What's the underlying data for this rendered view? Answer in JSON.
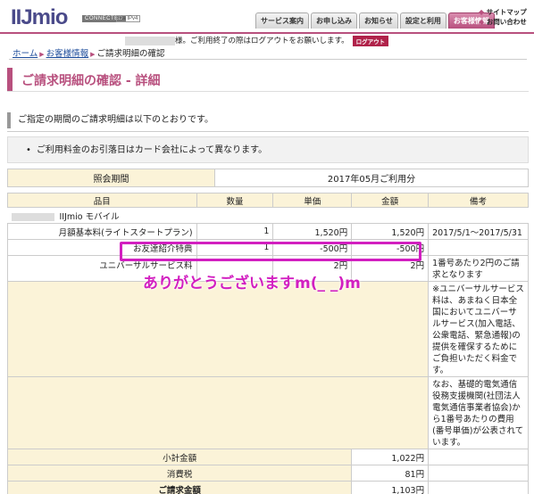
{
  "header": {
    "logo": "IIJmio",
    "connected": "CONNECTED",
    "ipv4": "via IPv4",
    "tabs": [
      {
        "label": "サービス案内",
        "active": false
      },
      {
        "label": "お申し込み",
        "active": false
      },
      {
        "label": "お知らせ",
        "active": false
      },
      {
        "label": "設定と利用",
        "active": false
      },
      {
        "label": "お客様情報",
        "active": true
      }
    ],
    "utility": [
      "サイトマップ",
      "お問い合わせ"
    ]
  },
  "notice": {
    "text": "様。ご利用終了の際はログアウトをお願いします。",
    "logout": "ログアウト"
  },
  "breadcrumb": {
    "home": "ホーム",
    "customer": "お客様情報",
    "current": "ご請求明細の確認"
  },
  "page_title": "ご請求明細の確認 - 詳細",
  "intro": "ご指定の期間のご請求明細は以下のとおりです。",
  "note": "ご利用料金のお引落日はカード会社によって異なります。",
  "period": {
    "label": "照会期間",
    "value": "2017年05月ご利用分"
  },
  "table": {
    "headers": [
      "品目",
      "数量",
      "単価",
      "金額",
      "備考"
    ],
    "group": "IIJmio モバイル",
    "rows": [
      {
        "item": "月額基本料(ライトスタートプラン)",
        "qty": "1",
        "unit": "1,520円",
        "amount": "1,520円",
        "remark": "2017/5/1～2017/5/31"
      },
      {
        "item": "お友達紹介特典",
        "qty": "1",
        "unit": "-500円",
        "amount": "-500円",
        "remark": ""
      },
      {
        "item": "ユニバーサルサービス料",
        "qty": "",
        "unit": "2円",
        "amount": "2円",
        "remark": "1番号あたり2円のご請求となります"
      }
    ],
    "remark_universal": "※ユニバーサルサービス料は、あまねく日本全国においてユニバーサルサービス(加入電話、公衆電話、緊急通報)の提供を確保するためにご負担いただく料金です。",
    "remark_cost": "なお、基礎的電気通信役務支援機関(社団法人電気通信事業者協会)から1番号あたりの費用(番号単価)が公表されています。",
    "subtotal_label": "小計金額",
    "subtotal": "1,022円",
    "tax_label": "消費税",
    "tax": "81円",
    "total_label": "ご請求金額",
    "total": "1,103円"
  },
  "overlay_text": "ありがとうございますm(_ _)m"
}
